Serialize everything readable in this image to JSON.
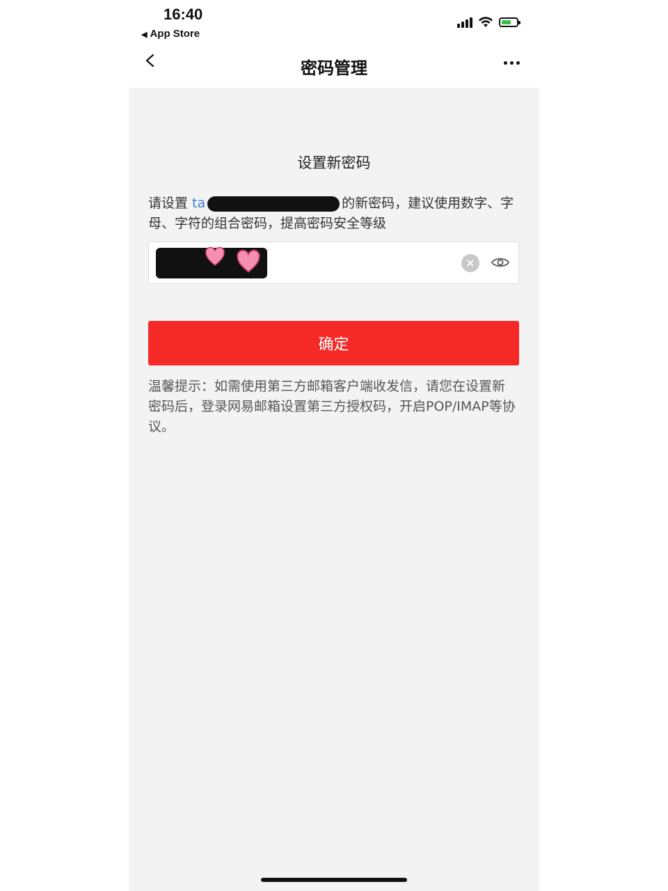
{
  "status_bar": {
    "time": "16:40",
    "back_app": "App Store"
  },
  "nav": {
    "title": "密码管理",
    "back_icon": "chevron-left-icon",
    "more_icon": "more-dots-icon"
  },
  "section_title": "设置新密码",
  "description": {
    "prefix": "请设置 ",
    "account_visible": "ta",
    "suffix": "的新密码，建议使用数字、字母、字符的组合密码，提高密码安全等级"
  },
  "password_field": {
    "placeholder": "",
    "clear_icon": "clear-icon",
    "eye_icon": "eye-icon"
  },
  "confirm_button": "确定",
  "tip": "温馨提示：如需使用第三方邮箱客户端收发信，请您在设置新密码后，登录网易邮箱设置第三方授权码，开启POP/IMAP等协议。",
  "colors": {
    "accent": "#f52a26",
    "link": "#3a7bd5",
    "background": "#f3f3f3"
  }
}
